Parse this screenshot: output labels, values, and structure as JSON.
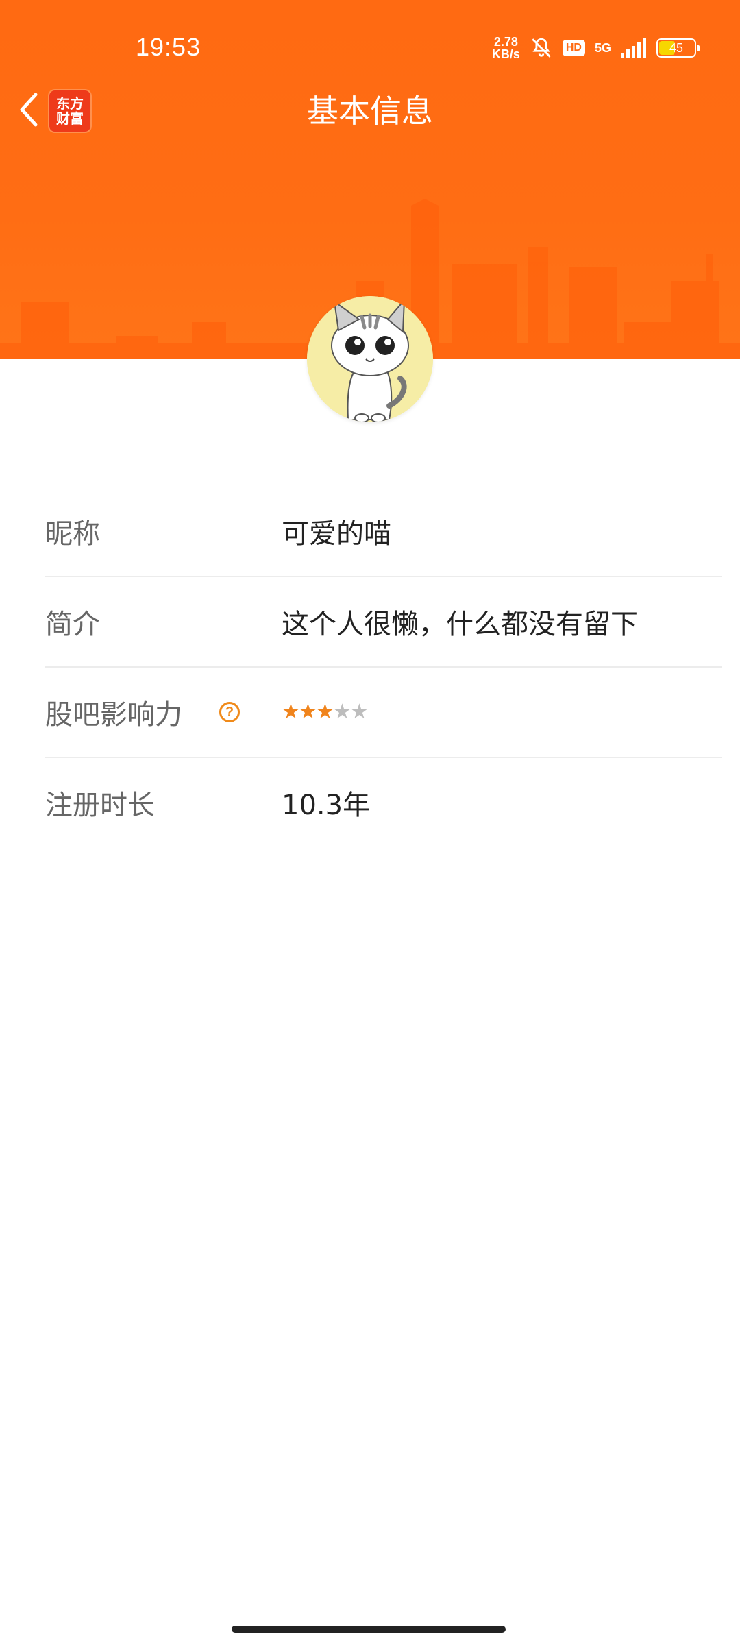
{
  "status_bar": {
    "time": "19:53",
    "net_speed_value": "2.78",
    "net_speed_unit": "KB/s",
    "hd_label": "HD",
    "network_label": "5G",
    "battery_level": "45",
    "battery_fraction": 0.45
  },
  "nav": {
    "title": "基本信息",
    "logo_line1": "东方",
    "logo_line2": "财富"
  },
  "profile": {
    "rows": [
      {
        "label": "昵称",
        "value": "可爱的喵"
      },
      {
        "label": "简介",
        "value": "这个人很懒，什么都没有留下"
      },
      {
        "label": "股吧影响力",
        "help_icon": "?",
        "rating": 3,
        "rating_max": 5
      },
      {
        "label": "注册时长",
        "value": "10.3年"
      }
    ]
  },
  "colors": {
    "header_orange": "#ff6a12",
    "accent_orange": "#f0841c",
    "logo_red": "#ee3a1a"
  },
  "icons": {
    "back": "chevron-left-icon",
    "help": "question-circle-icon",
    "mute": "bell-off-icon",
    "signal": "cellular-signal-icon",
    "battery": "battery-icon"
  }
}
